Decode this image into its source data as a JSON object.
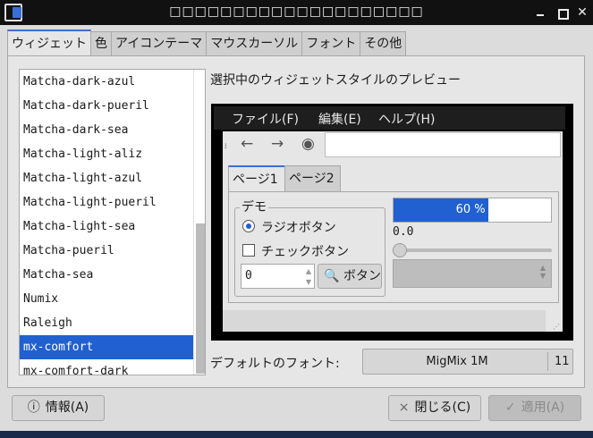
{
  "window": {
    "title": "□□□□□□□□□□□□□□□□□□□□"
  },
  "tabs": [
    {
      "label": "ウィジェット"
    },
    {
      "label": "色"
    },
    {
      "label": "アイコンテーマ"
    },
    {
      "label": "マウスカーソル"
    },
    {
      "label": "フォント"
    },
    {
      "label": "その他"
    }
  ],
  "theme_list": {
    "items": [
      "Matcha-dark-azul",
      "Matcha-dark-pueril",
      "Matcha-dark-sea",
      "Matcha-light-aliz",
      "Matcha-light-azul",
      "Matcha-light-pueril",
      "Matcha-light-sea",
      "Matcha-pueril",
      "Matcha-sea",
      "Numix",
      "Raleigh",
      "mx-comfort",
      "mx-comfort-dark"
    ],
    "selected": "mx-comfort"
  },
  "preview": {
    "label": "選択中のウィジェットスタイルのプレビュー",
    "menu": [
      "ファイル(F)",
      "編集(E)",
      "ヘルプ(H)"
    ],
    "tabs": [
      "ページ1",
      "ページ2"
    ],
    "frame_label": "デモ",
    "radio_label": "ラジオボタン",
    "check_label": "チェックボタン",
    "spin_value": "0",
    "button_label": "ボタン",
    "progress": {
      "value": 60,
      "text": "60 %"
    },
    "scale_value": "0.0"
  },
  "font": {
    "label": "デフォルトのフォント:",
    "name": "MigMix 1M",
    "size": "11"
  },
  "buttons": {
    "info": "情報(A)",
    "close": "閉じる(C)",
    "apply": "適用(A)"
  }
}
